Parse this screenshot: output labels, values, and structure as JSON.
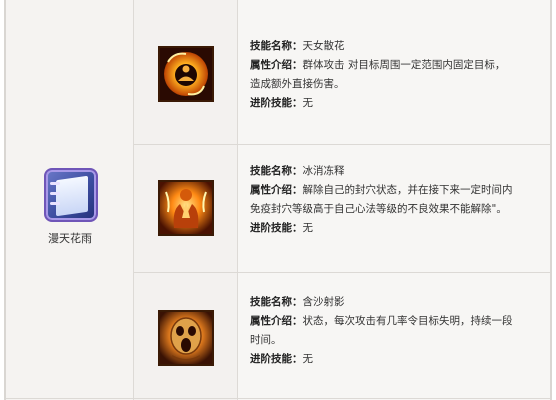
{
  "book": {
    "name": "漫天花雨",
    "icon": "blue-skill-book-icon"
  },
  "labels": {
    "name": "技能名称：",
    "desc": "属性介绍：",
    "advanced": "进阶技能："
  },
  "skills": [
    {
      "icon": "fire-orb-meditation-icon",
      "name": "天女散花",
      "desc_lines": [
        "群体攻击  对目标周围一定范围内固定目标，",
        "造成额外直接伤害。"
      ],
      "advanced": "无"
    },
    {
      "icon": "fiery-praying-figure-icon",
      "name": "冰消冻释",
      "desc_lines": [
        "解除自己的封穴状态，并在接下来一定时间内",
        "免疫封穴等级高于自己心法等级的不良效果不能解除\"。"
      ],
      "advanced": "无"
    },
    {
      "icon": "screaming-skull-icon",
      "name": "含沙射影",
      "desc_lines": [
        "状态，每次攻击有几率令目标失明，持续一段",
        "时间。"
      ],
      "advanced": "无"
    }
  ],
  "colors": {
    "border": "#d9d6d2",
    "fire": "#ff8c1a",
    "book": "#3c4da0"
  }
}
